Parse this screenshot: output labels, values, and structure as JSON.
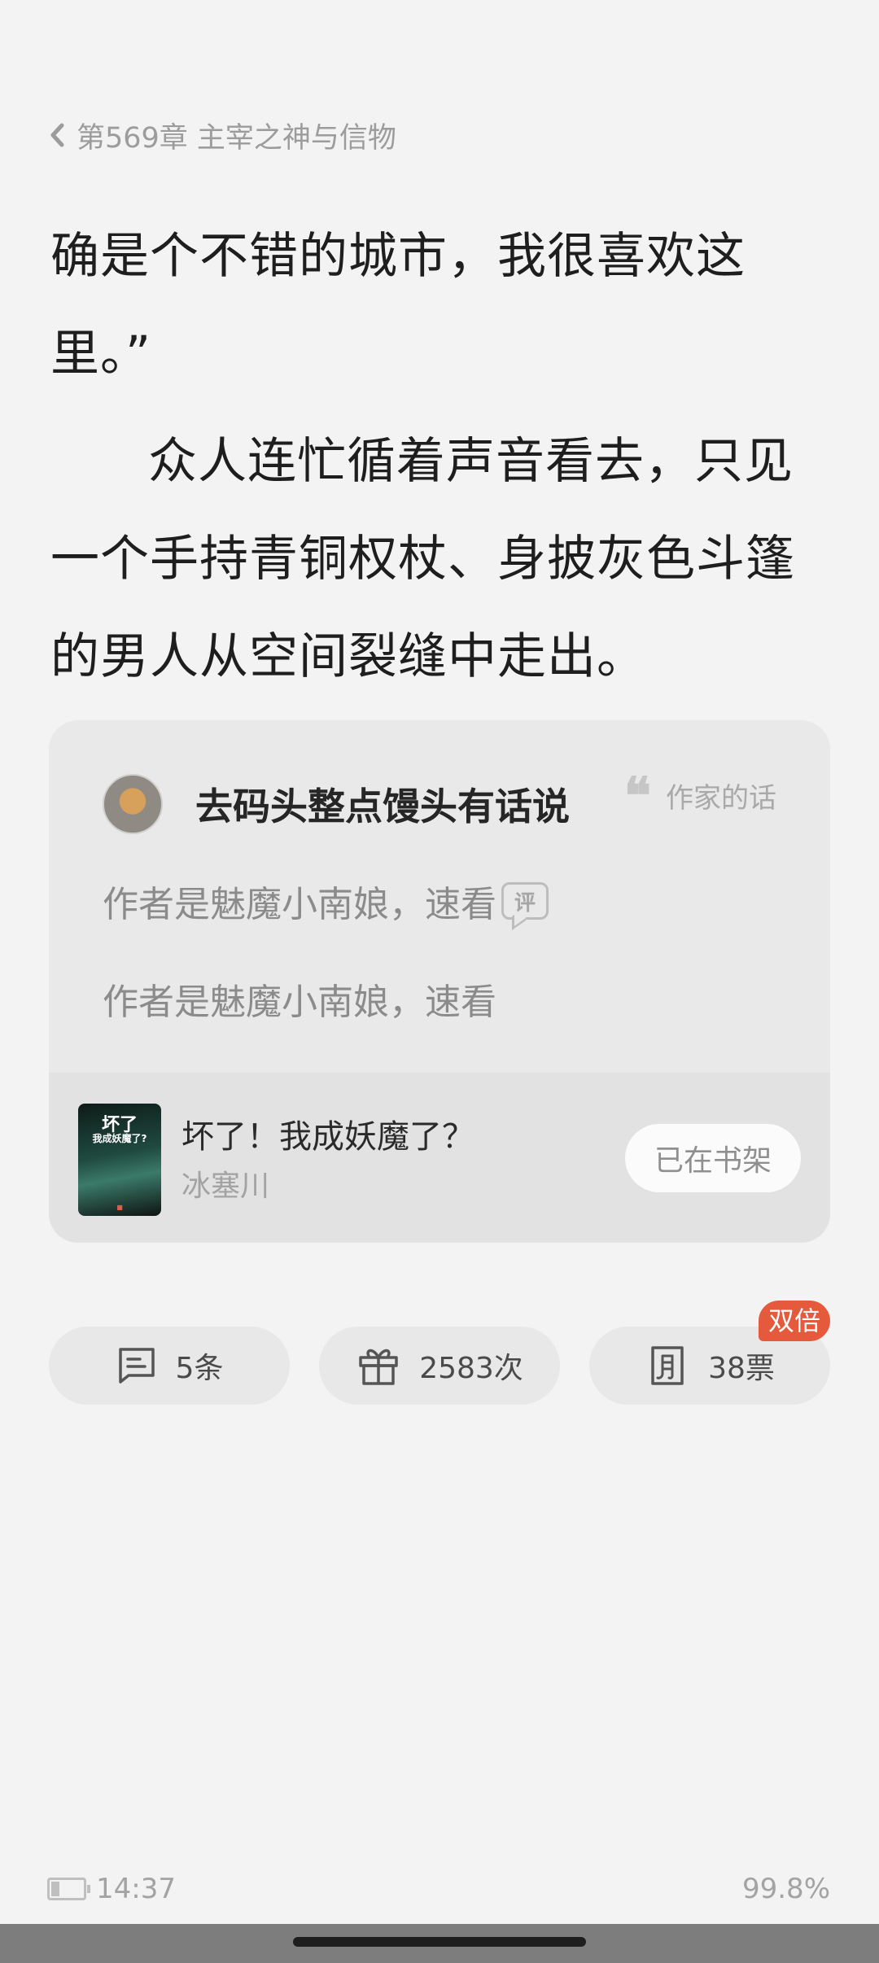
{
  "header": {
    "chapter_title": "第569章 主宰之神与信物"
  },
  "content": {
    "paragraphs": [
      "确是个不错的城市，我很喜欢这里。”",
      "众人连忙循着声音看去，只见一个手持青铜权杖、身披灰色斗篷的男人从空间裂缝中走出。"
    ]
  },
  "author_card": {
    "author_name": "去码头整点馒头有话说",
    "tag_label": "作家的话",
    "messages": [
      "作者是魅魔小南娘，速看",
      "作者是魅魔小南娘，速看"
    ],
    "review_badge": "评",
    "book": {
      "cover_title": "坏了",
      "cover_subtitle": "我成妖魔了?",
      "title": "坏了！我成妖魔了？",
      "author": "冰塞川",
      "shelf_button": "已在书架"
    }
  },
  "actions": {
    "comments": "5条",
    "gifts": "2583次",
    "votes": "38票",
    "votes_badge": "双倍"
  },
  "status": {
    "time": "14:37",
    "progress": "99.8%"
  },
  "colors": {
    "background": "#f3f3f3",
    "badge": "#e55a3c",
    "card": "#e9e9e9"
  },
  "icons": [
    "chevron-left-icon",
    "quote-icon",
    "comment-icon",
    "gift-icon",
    "monthly-ticket-icon",
    "battery-icon"
  ]
}
